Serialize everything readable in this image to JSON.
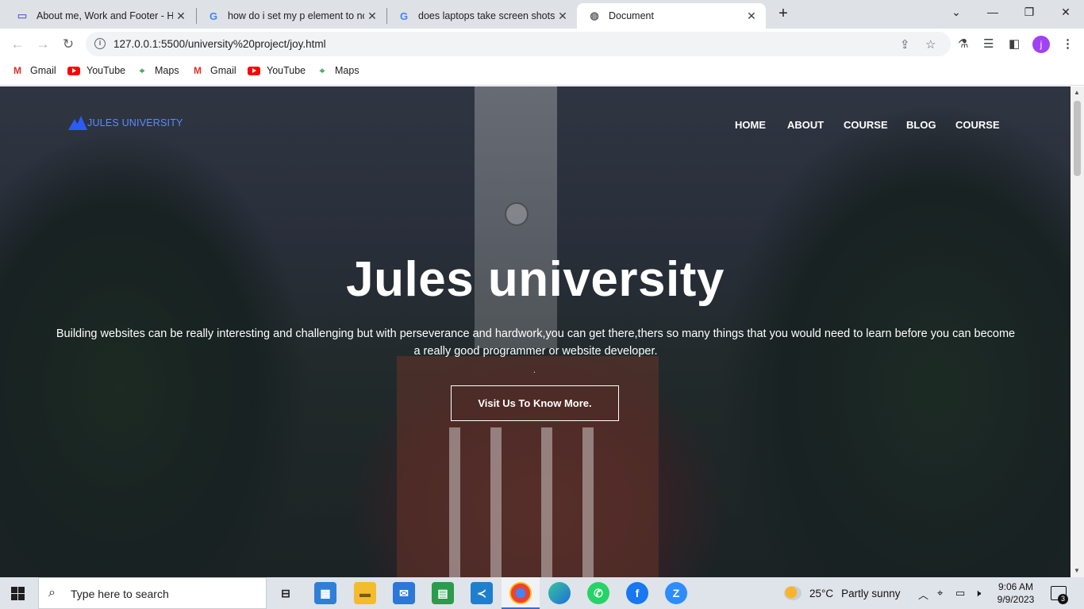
{
  "browser": {
    "tabs": [
      {
        "title": "About me, Work and Footer - HT",
        "icon": "codepen-icon",
        "active": false
      },
      {
        "title": "how do i set my p element to no",
        "icon": "google-icon",
        "active": false
      },
      {
        "title": "does laptops take screen shots -",
        "icon": "google-icon",
        "active": false
      },
      {
        "title": "Document",
        "icon": "globe-icon",
        "active": true
      }
    ],
    "url": "127.0.0.1:5500/university%20project/joy.html",
    "profile_initial": "j",
    "bookmarks": [
      {
        "label": "Gmail",
        "icon": "gmail-icon"
      },
      {
        "label": "YouTube",
        "icon": "youtube-icon"
      },
      {
        "label": "Maps",
        "icon": "maps-icon"
      },
      {
        "label": "Gmail",
        "icon": "gmail-icon"
      },
      {
        "label": "YouTube",
        "icon": "youtube-icon"
      },
      {
        "label": "Maps",
        "icon": "maps-icon"
      }
    ]
  },
  "site": {
    "logo_text": "JULES UNIVERSITY",
    "nav": [
      "HOME",
      "ABOUT",
      "COURSE",
      "BLOG",
      "COURSE"
    ],
    "hero_title": "Jules university",
    "hero_text": "Building websites can be really interesting and challenging but with perseverance and hardwork,you can get there,thers so many things that you would need to learn before you can become a really good programmer or website developer.",
    "hero_dot": ".",
    "hero_button": "Visit Us To Know More.",
    "colors": {
      "logo": "#2c5cf5",
      "overlay": "#191c28"
    }
  },
  "taskbar": {
    "search_placeholder": "Type here to search",
    "weather_temp": "25°C",
    "weather_desc": "Partly sunny",
    "time": "9:06 AM",
    "date": "9/9/2023",
    "notification_count": "3"
  }
}
